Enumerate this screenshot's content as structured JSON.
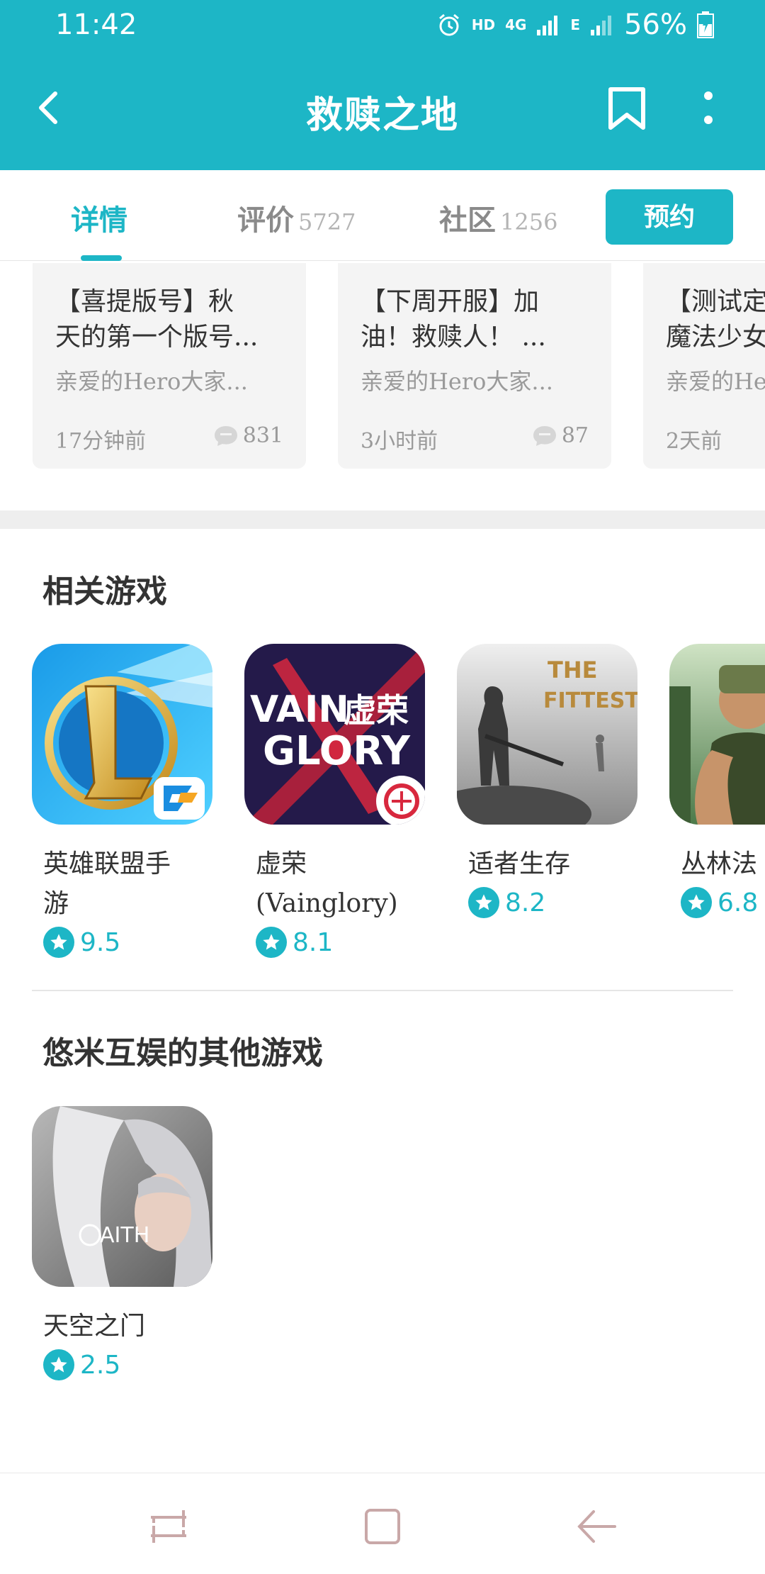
{
  "status_bar": {
    "time": "11:42",
    "hd_label": "HD",
    "network_label": "4G",
    "e_label": "E",
    "battery_percent": "56%",
    "battery_level": 0.56
  },
  "app_bar": {
    "title": "救赎之地"
  },
  "tabs": [
    {
      "label": "详情",
      "count": ""
    },
    {
      "label": "评价",
      "count": "5727"
    },
    {
      "label": "社区",
      "count": "1256"
    }
  ],
  "reserve_button": "预约",
  "posts": [
    {
      "title_line1": "【喜提版号】秋",
      "title_line2": "天的第一个版号...",
      "preview": "亲爱的Hero大家...",
      "time": "17分钟前",
      "comments": "831"
    },
    {
      "title_line1": "【下周开服】加",
      "title_line2": "油！救赎人！ ...",
      "preview": "亲爱的Hero大家...",
      "time": "3小时前",
      "comments": "87"
    },
    {
      "title_line1": "【测试定",
      "title_line2": "魔法少女",
      "preview": "亲爱的Hero",
      "time": "2天前",
      "comments": ""
    }
  ],
  "related_section": {
    "title": "相关游戏",
    "games": [
      {
        "name_line1": "英雄联盟手",
        "name_line2": "游",
        "rating": "9.5"
      },
      {
        "name_line1": "虚荣",
        "name_line2": "(Vainglory)",
        "rating": "8.1",
        "icon_text1": "VAIN",
        "icon_text2": "虚荣",
        "icon_text3": "GLORY"
      },
      {
        "name_line1": "适者生存",
        "name_line2": "",
        "rating": "8.2",
        "icon_text1": "THE",
        "icon_text2": "FITTEST"
      },
      {
        "name_line1": "丛林法",
        "name_line2": "",
        "rating": "6.8"
      }
    ]
  },
  "other_section": {
    "title": "悠米互娱的其他游戏",
    "games": [
      {
        "name_line1": "天空之门",
        "name_line2": "",
        "rating": "2.5",
        "icon_text1": "AITH"
      }
    ]
  },
  "colors": {
    "accent": "#1db6c6",
    "text_dark": "#333333",
    "text_muted": "#9a9a9a"
  }
}
